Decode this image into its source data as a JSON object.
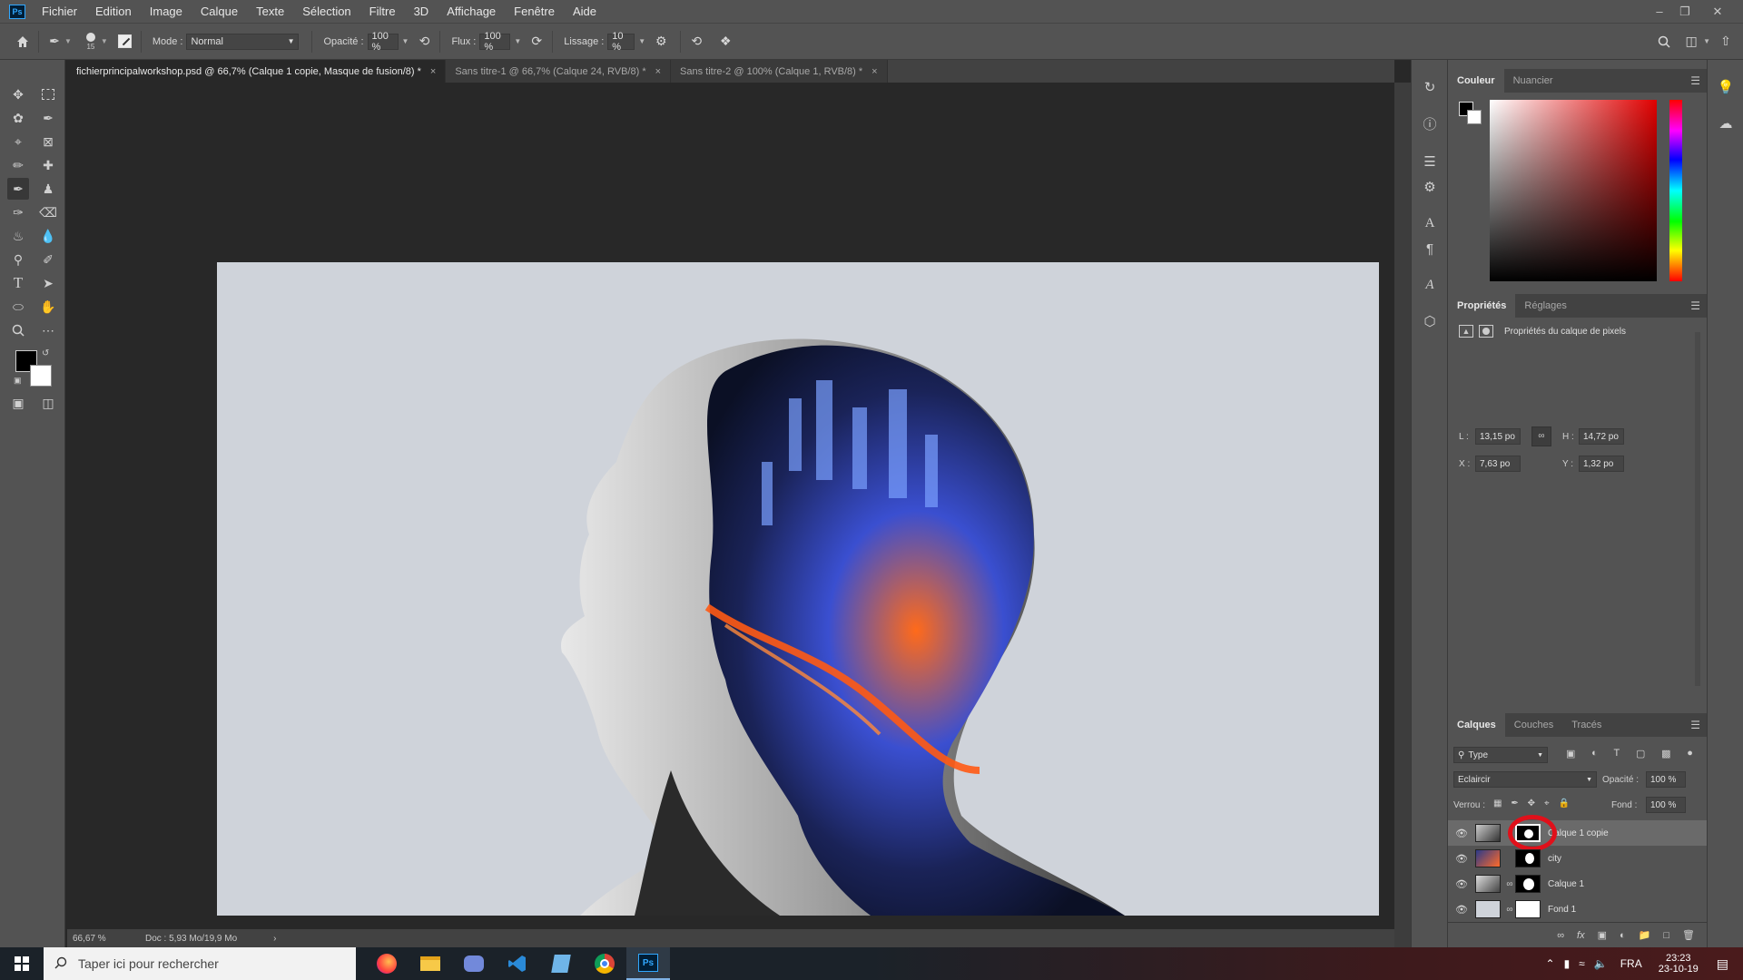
{
  "app": {
    "logo": "Ps"
  },
  "menu": [
    "Fichier",
    "Edition",
    "Image",
    "Calque",
    "Texte",
    "Sélection",
    "Filtre",
    "3D",
    "Affichage",
    "Fenêtre",
    "Aide"
  ],
  "options": {
    "brush_size": "15",
    "mode_label": "Mode :",
    "mode_value": "Normal",
    "opacity_label": "Opacité :",
    "opacity_value": "100 %",
    "flow_label": "Flux :",
    "flow_value": "100 %",
    "smoothing_label": "Lissage :",
    "smoothing_value": "10 %"
  },
  "tabs": [
    {
      "label": "fichierprincipalworkshop.psd @ 66,7% (Calque 1 copie, Masque de fusion/8) *",
      "active": true
    },
    {
      "label": "Sans titre-1 @ 66,7% (Calque 24, RVB/8) *",
      "active": false
    },
    {
      "label": "Sans titre-2 @ 100% (Calque 1, RVB/8) *",
      "active": false
    }
  ],
  "status": {
    "zoom": "66,67 %",
    "doc": "Doc : 5,93 Mo/19,9 Mo"
  },
  "color_panel": {
    "tabs": [
      "Couleur",
      "Nuancier"
    ]
  },
  "properties": {
    "tabs": [
      "Propriétés",
      "Réglages"
    ],
    "header": "Propriétés du calque de pixels",
    "w_label": "L :",
    "w_value": "13,15 po",
    "h_label": "H :",
    "h_value": "14,72 po",
    "x_label": "X :",
    "x_value": "7,63 po",
    "y_label": "Y :",
    "y_value": "1,32 po"
  },
  "layers": {
    "tabs": [
      "Calques",
      "Couches",
      "Tracés"
    ],
    "filter": "Type",
    "blend_mode": "Eclaircir",
    "opacity_label": "Opacité :",
    "opacity_value": "100 %",
    "lock_label": "Verrou :",
    "fill_label": "Fond :",
    "fill_value": "100 %",
    "items": [
      {
        "name": "Calque 1 copie",
        "selected": true
      },
      {
        "name": "city",
        "selected": false
      },
      {
        "name": "Calque 1",
        "selected": false
      },
      {
        "name": "Fond 1",
        "selected": false
      }
    ]
  },
  "taskbar": {
    "search_placeholder": "Taper ici pour rechercher",
    "lang": "FRA",
    "time": "23:23",
    "date": "23-10-19"
  },
  "colors": {
    "accent": "#31a8ff",
    "highlight_circle": "#e0101a"
  }
}
